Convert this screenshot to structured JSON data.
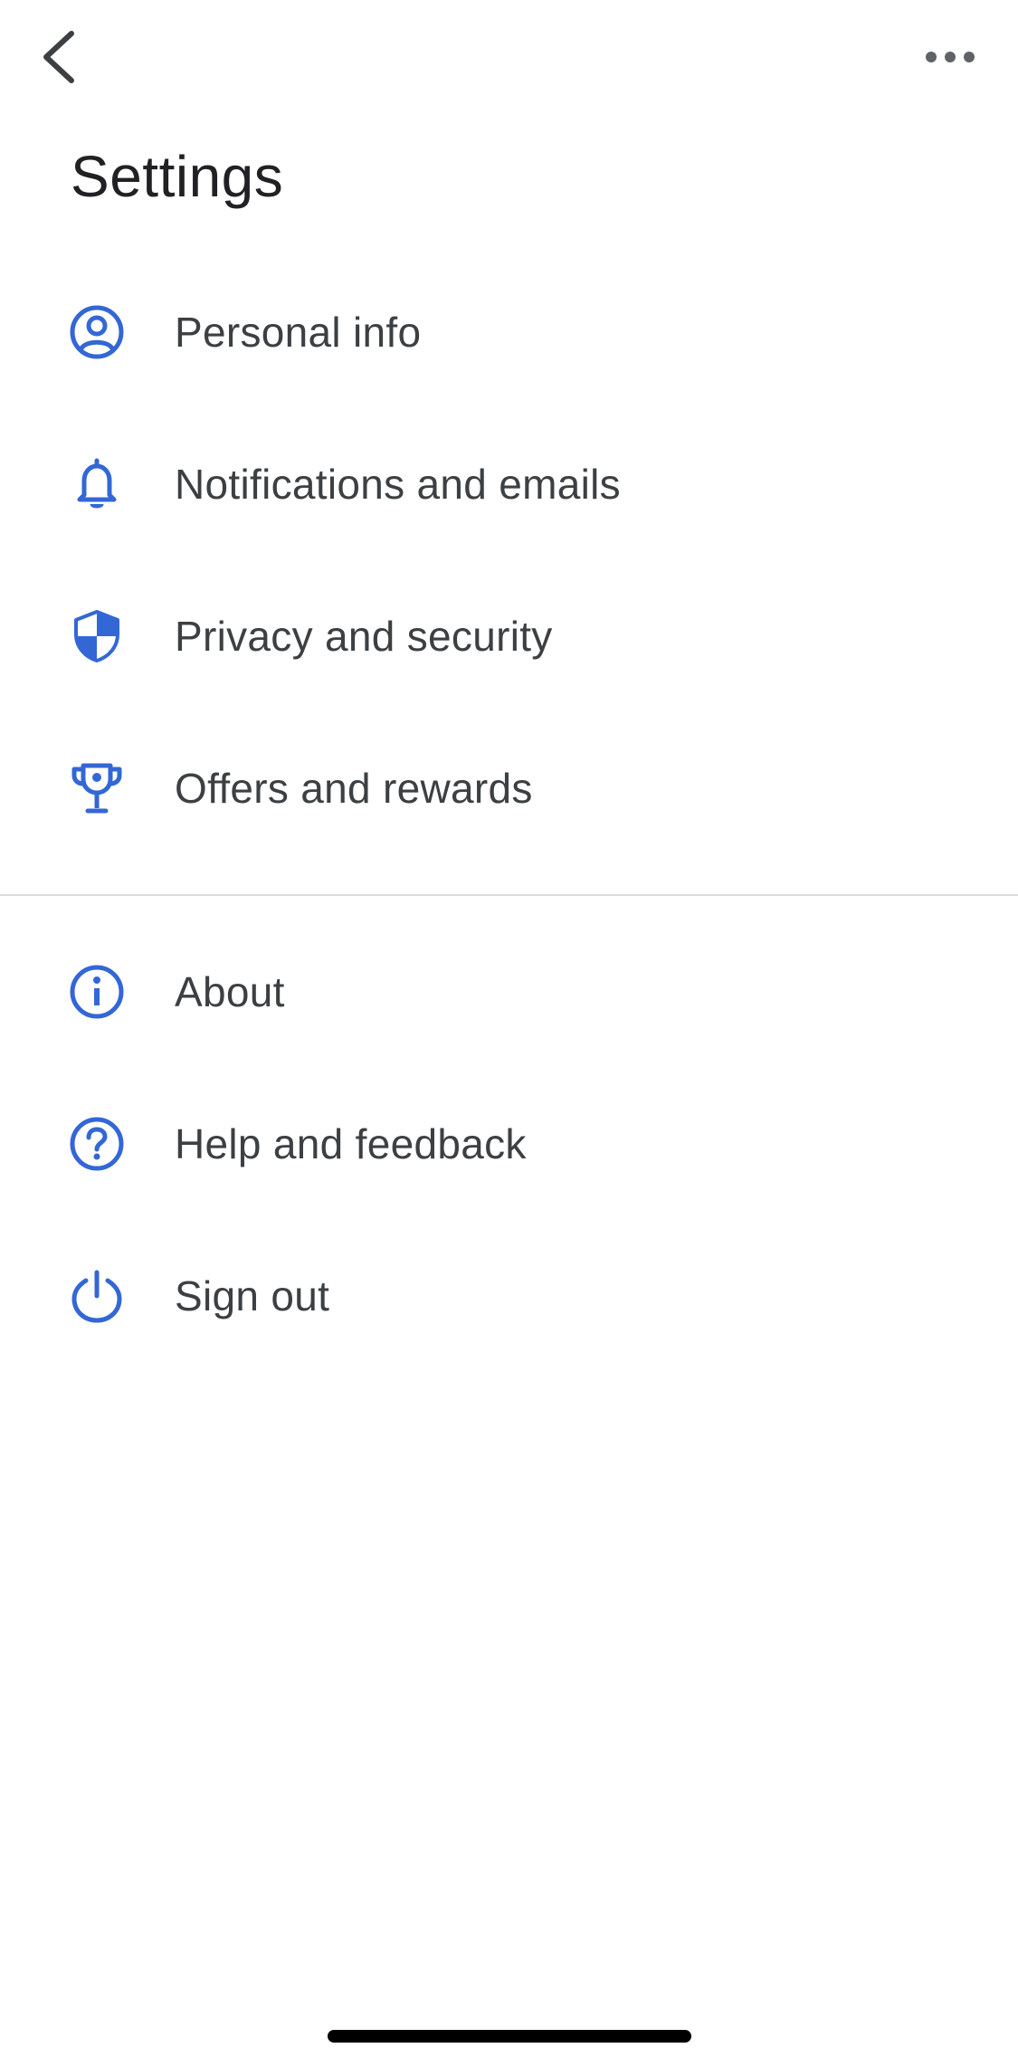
{
  "header": {
    "title": "Settings",
    "back_icon": "chevron-left-icon",
    "more_icon": "more-horizontal-icon"
  },
  "colors": {
    "accent": "#1a73e8",
    "icon": "#3367d6",
    "text": "#3c4043",
    "divider": "#dadce0"
  },
  "menu": {
    "primary": [
      {
        "label": "Personal info",
        "icon": "account-circle-icon"
      },
      {
        "label": "Notifications and emails",
        "icon": "bell-icon"
      },
      {
        "label": "Privacy and security",
        "icon": "shield-icon"
      },
      {
        "label": "Offers and rewards",
        "icon": "trophy-icon"
      }
    ],
    "secondary": [
      {
        "label": "About",
        "icon": "info-icon"
      },
      {
        "label": "Help and feedback",
        "icon": "help-icon"
      },
      {
        "label": "Sign out",
        "icon": "power-icon"
      }
    ]
  }
}
